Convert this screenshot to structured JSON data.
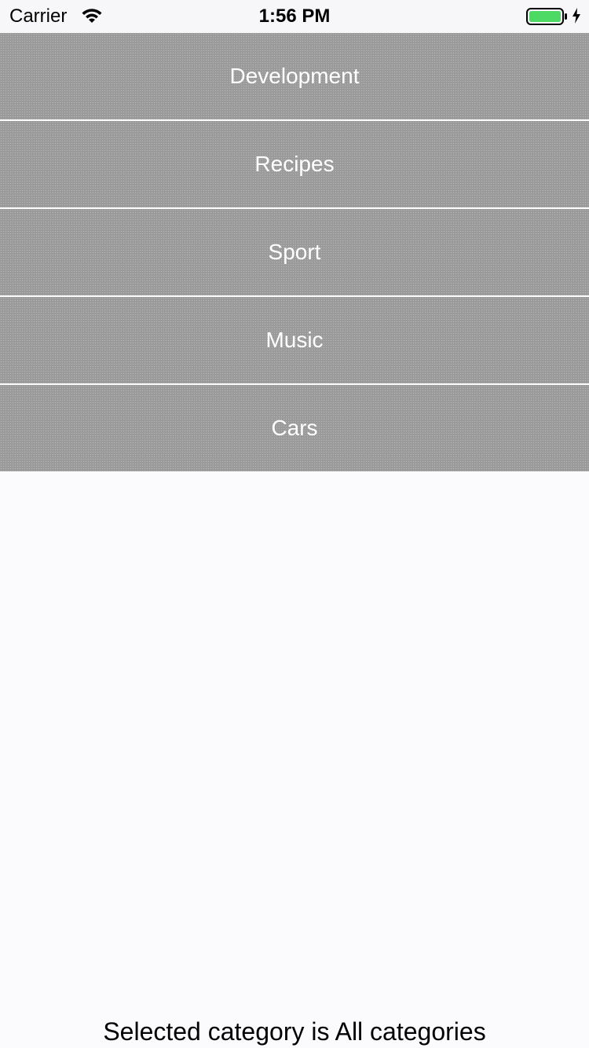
{
  "status_bar": {
    "carrier": "Carrier",
    "time": "1:56 PM",
    "wifi_icon": "wifi-icon",
    "battery_icon": "battery-icon",
    "charging_icon": "charging-bolt-icon",
    "battery_color": "#4cd964"
  },
  "categories": [
    {
      "label": "Development"
    },
    {
      "label": "Recipes"
    },
    {
      "label": "Sport"
    },
    {
      "label": "Music"
    },
    {
      "label": "Cars"
    }
  ],
  "selected_text": "Selected category is All categories",
  "colors": {
    "row_background": "#9a9a9a",
    "row_text": "#ffffff",
    "page_background": "#fbfbfd"
  }
}
